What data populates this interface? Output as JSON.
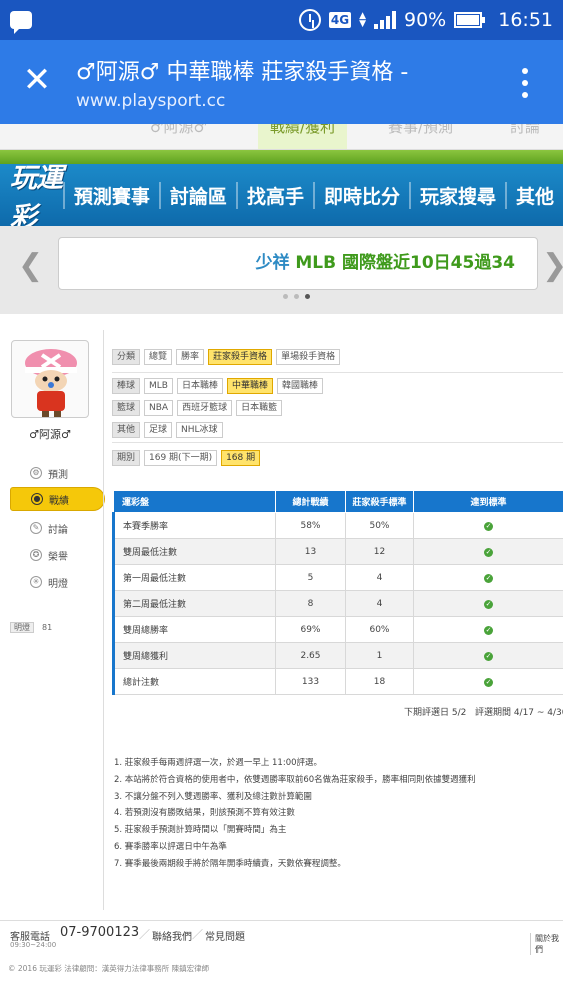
{
  "status_bar": {
    "network": "4G",
    "battery": "90%",
    "time": "16:51"
  },
  "browser": {
    "title": "♂阿源♂ 中華職棒 莊家殺手資格 -",
    "url": "www.playsport.cc"
  },
  "subtabs": {
    "left": "♂阿源♂",
    "active": "戰績/獲利",
    "right1": "賽事/預測",
    "right2": "討論"
  },
  "nav": {
    "logo": "玩運彩",
    "items": [
      "預測賽事",
      "討論區",
      "找高手",
      "即時比分",
      "玩家搜尋",
      "其他"
    ]
  },
  "banner": {
    "text_prefix": "少祥 ",
    "text_highlight": "MLB 國際盤近10日45過34"
  },
  "sidebar": {
    "username": "♂阿源♂",
    "items": [
      "預測",
      "戰績",
      "討論",
      "榮譽",
      "明燈"
    ],
    "tag_label": "明燈",
    "tag_value": "81"
  },
  "filters": {
    "category": {
      "label": "分類",
      "options": [
        "總覽",
        "勝率",
        "莊家殺手資格",
        "單場殺手資格"
      ],
      "selected": 2
    },
    "baseball": {
      "label": "棒球",
      "options": [
        "MLB",
        "日本職棒",
        "中華職棒",
        "韓國職棒"
      ],
      "selected": 2
    },
    "basketball": {
      "label": "籃球",
      "options": [
        "NBA",
        "西班牙籃球",
        "日本職籃"
      ],
      "selected": -1
    },
    "other": {
      "label": "其他",
      "options": [
        "足球",
        "NHL冰球"
      ],
      "selected": -1
    },
    "period": {
      "label": "期別",
      "options": [
        "169 期(下一期)",
        "168 期"
      ],
      "selected": 1
    }
  },
  "table": {
    "headers": [
      "運彩盤",
      "總計戰績",
      "莊家殺手標準",
      "達到標準"
    ],
    "rows": [
      [
        "本賽季勝率",
        "58%",
        "50%"
      ],
      [
        "雙周最低注數",
        "13",
        "12"
      ],
      [
        "第一周最低注數",
        "5",
        "4"
      ],
      [
        "第二周最低注數",
        "8",
        "4"
      ],
      [
        "雙周總勝率",
        "69%",
        "60%"
      ],
      [
        "雙周總獲利",
        "2.65",
        "1"
      ],
      [
        "總計注數",
        "133",
        "18"
      ]
    ],
    "check": "✓"
  },
  "period_note": {
    "next_eval": "下期評選日 5/2",
    "eval_period": "評選期間 4/17 ~ 4/30"
  },
  "rules": [
    "1. 莊家殺手每兩週評選一次，於週一早上 11:00評選。",
    "2. 本站將於符合資格的使用者中，依雙週勝率取前60名做為莊家殺手，勝率相同則依據雙週獲利",
    "3. 不讓分盤不列入雙週勝率、獲利及總注數計算範圍",
    "4. 若預測沒有勝敗結果，則該預測不算有效注數",
    "5. 莊家殺手預測計算時間以「開賽時間」為主",
    "6. 賽季勝率以評選日中午為準",
    "7. 賽季最後兩期殺手將於隔年開季時續責，天數依賽程調整。"
  ],
  "footer": {
    "phone_label": "客服電話",
    "hours": "09:30~24:00",
    "phone": "07-9700123",
    "links": [
      "聯絡我們",
      "常見問題"
    ],
    "right": "關於我們",
    "copyright": "© 2016 玩運彩  法律顧問：漢英得力法律事務所 陳鎮宏律師"
  }
}
